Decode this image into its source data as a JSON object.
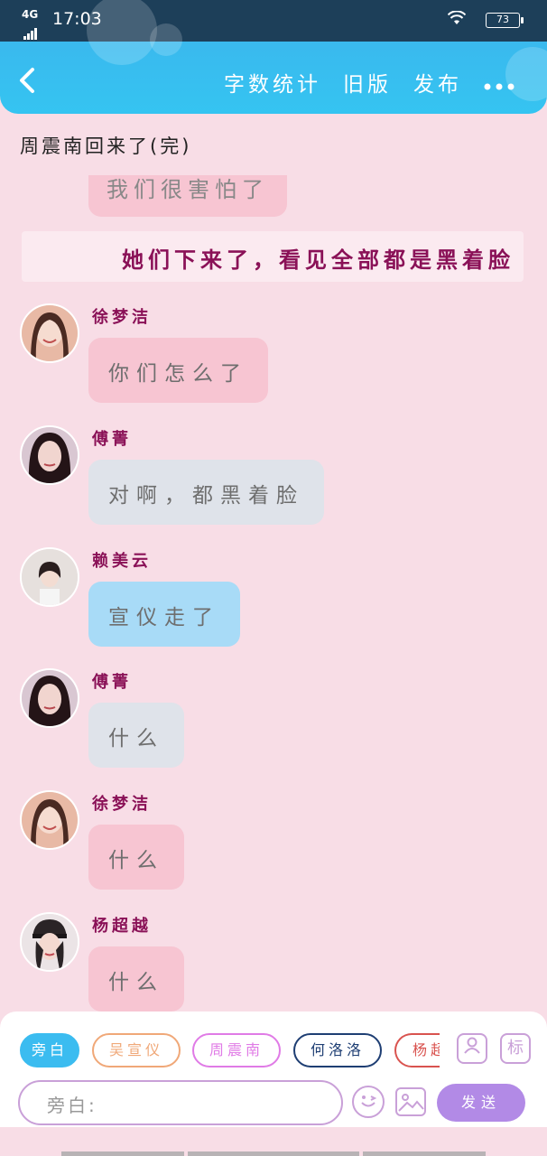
{
  "status_bar": {
    "network": "4G",
    "time": "17:03",
    "battery": "73"
  },
  "header": {
    "back_icon": "chevron-left-icon",
    "word_count": "字数统计",
    "old_version": "旧版",
    "publish": "发布",
    "more_icon": "more-dots-icon"
  },
  "story_title": "周震南回来了(完)",
  "chat": {
    "partial_message": "我们很害怕了",
    "narration": "她们下来了，看见全部都是黑着脸",
    "messages": [
      {
        "name": "徐梦洁",
        "text": "你们怎么了",
        "bubble_color": "#f7c5d2",
        "avatar_bg": "#e8b9a5"
      },
      {
        "name": "傅菁",
        "text": "对啊，都黑着脸",
        "bubble_color": "#dfe3ea",
        "avatar_bg": "#3c2b2e"
      },
      {
        "name": "赖美云",
        "text": "宣仪走了",
        "bubble_color": "#a8dbf7",
        "avatar_bg": "#d9d2cf"
      },
      {
        "name": "傅菁",
        "text": "什么",
        "bubble_color": "#dfe3ea",
        "avatar_bg": "#3c2b2e"
      },
      {
        "name": "徐梦洁",
        "text": "什么",
        "bubble_color": "#f7c5d2",
        "avatar_bg": "#e8b9a5"
      },
      {
        "name": "杨超越",
        "text": "什么",
        "bubble_color": "#f7c5d2",
        "avatar_bg": "#2a2426"
      }
    ]
  },
  "characters": [
    {
      "label": "旁白",
      "color": "#3bbcf0",
      "selected": true
    },
    {
      "label": "吴宣仪",
      "color": "#f0a878",
      "selected": false
    },
    {
      "label": "周震南",
      "color": "#e07be6",
      "selected": false
    },
    {
      "label": "何洛洛",
      "color": "#1e3e73",
      "selected": false
    },
    {
      "label": "杨超越",
      "color": "#d9534f",
      "selected": false
    }
  ],
  "toolbar": {
    "person_icon": "person-icon",
    "tag_label": "标",
    "input_placeholder": "旁白:",
    "emoji_icon": "smiley-icon",
    "image_icon": "image-icon",
    "send_label": "发送"
  }
}
